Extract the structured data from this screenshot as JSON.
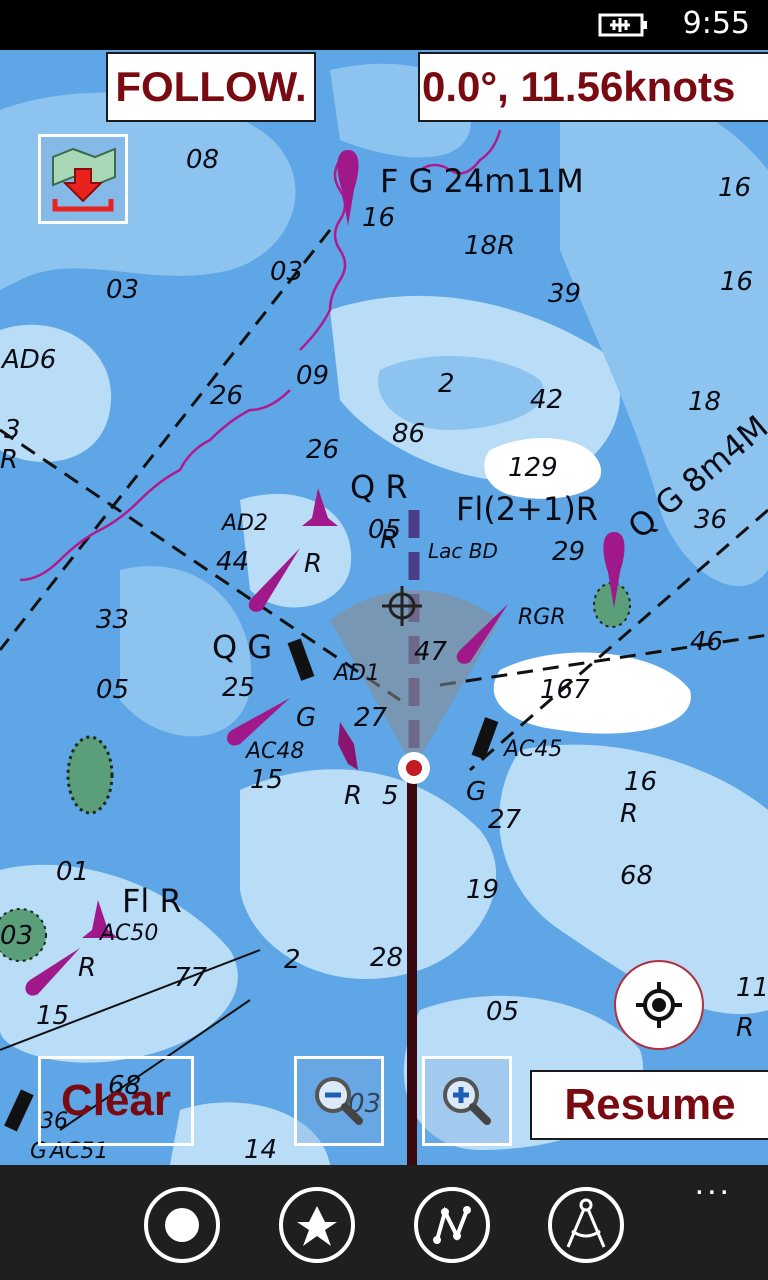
{
  "status_bar": {
    "time": "9:55",
    "battery_icon": "battery-charging-icon"
  },
  "map": {
    "mode_label": "FOLLOW.",
    "course_speed": "0.0°, 11.56knots",
    "depths": [
      "08",
      "16",
      "18R",
      "03",
      "03",
      "39",
      "16",
      "AD6",
      "26",
      "09",
      "2",
      "42",
      "18",
      "3",
      "R",
      "86",
      "26",
      "129",
      "05",
      "36",
      "44",
      "R",
      "R",
      "29",
      "33",
      "05",
      "25",
      "G",
      "27",
      "AC48",
      "15",
      "R",
      "5",
      "G",
      "27",
      "47",
      "167",
      "16",
      "R",
      "46",
      "01",
      "19",
      "68",
      "03",
      "R",
      "2",
      "28",
      "77",
      "15",
      "05",
      "11",
      "R",
      "14",
      "03",
      "68",
      "36",
      "AC51",
      "G",
      "AD1",
      "AD2",
      "AC45",
      "RGR",
      "AC50",
      "Lac BD"
    ],
    "light_labels": [
      "F G 24m11M",
      "Q R",
      "Fl(2+1)R",
      "Q G 8m4M",
      "Q G",
      "Fl R"
    ],
    "colors": {
      "deep_water": "#5fa6e6",
      "shallow_water": "#b9dcf7",
      "land": "#ffffff",
      "route": "#3a0a10",
      "heading": "#4b3d8a",
      "buoy": "#a0198a"
    }
  },
  "buttons": {
    "download_charts": "download-map-icon",
    "clear": "Clear",
    "zoom_out": "zoom-out-icon",
    "zoom_in": "zoom-in-icon",
    "resume": "Resume",
    "center_location": "target-icon"
  },
  "app_bar": {
    "items": [
      "record-icon",
      "waypoint-icon",
      "route-icon",
      "compass-divider-icon"
    ],
    "more": "..."
  }
}
